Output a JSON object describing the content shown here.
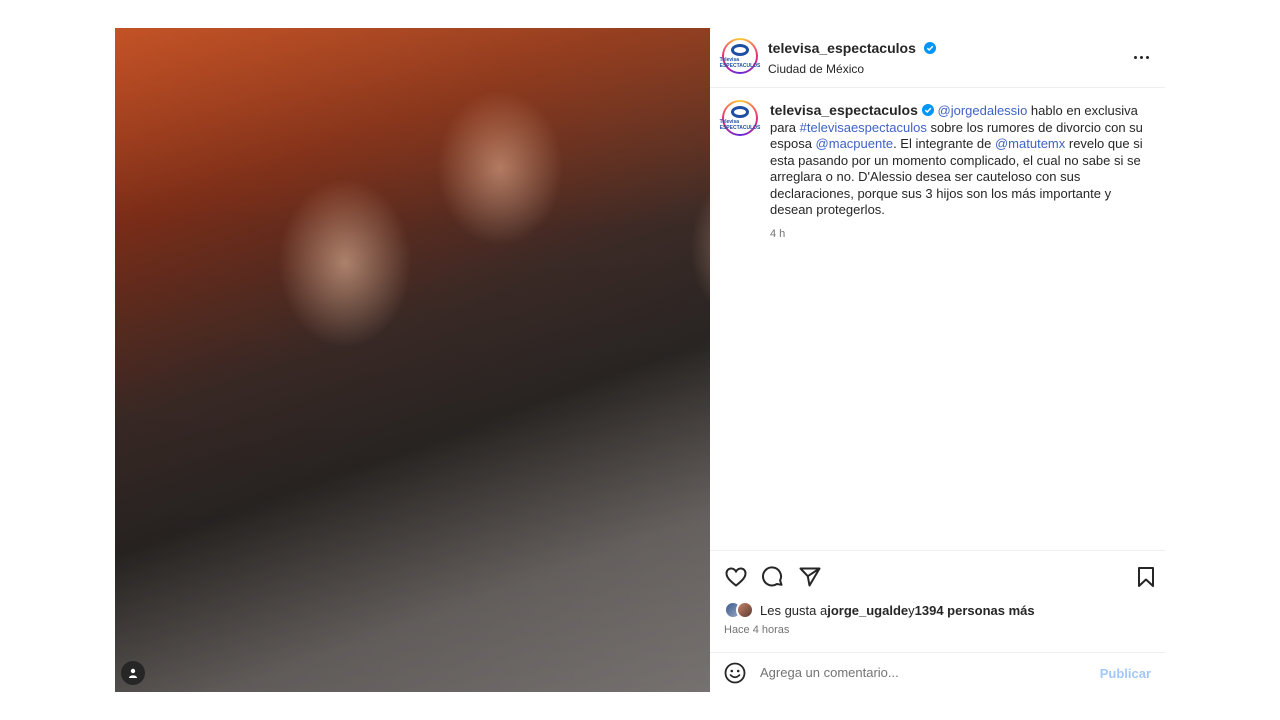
{
  "post": {
    "account": "televisa_espectaculos",
    "location": "Ciudad de México",
    "avatar_text": "Televisa ESPECTACULOS"
  },
  "caption": {
    "username": "televisa_espectaculos",
    "mention_1": "@jorgedalessio",
    "text_1": " hablo en exclusiva para ",
    "hashtag": "#televisaespectaculos",
    "text_2": " sobre los rumores de divorcio con su esposa ",
    "mention_2": "@macpuente",
    "text_3": ". El integrante de ",
    "mention_3": "@matutemx",
    "text_4": " revelo que si esta pasando por un momento complicado, el cual no sabe si se arreglara o no. D'Alessio desea ser cauteloso con sus declaraciones, porque sus 3 hijos son los más importante y desean protegerlos.",
    "time": "4 h"
  },
  "likes": {
    "prefix": "Les gusta a ",
    "user": "jorge_ugalde",
    "middle": " y ",
    "count": "1394 personas más",
    "posted": "Hace 4 horas"
  },
  "comment": {
    "placeholder": "Agrega un comentario...",
    "publish_label": "Publicar"
  },
  "icons": [
    "user-tag-icon",
    "verified-icon",
    "more-options-icon",
    "like-icon",
    "comment-icon",
    "share-icon",
    "save-icon",
    "emoji-icon"
  ],
  "colors": {
    "link": "#3f62c4",
    "verified": "#0095f6",
    "publish": "#a3c8f7"
  }
}
